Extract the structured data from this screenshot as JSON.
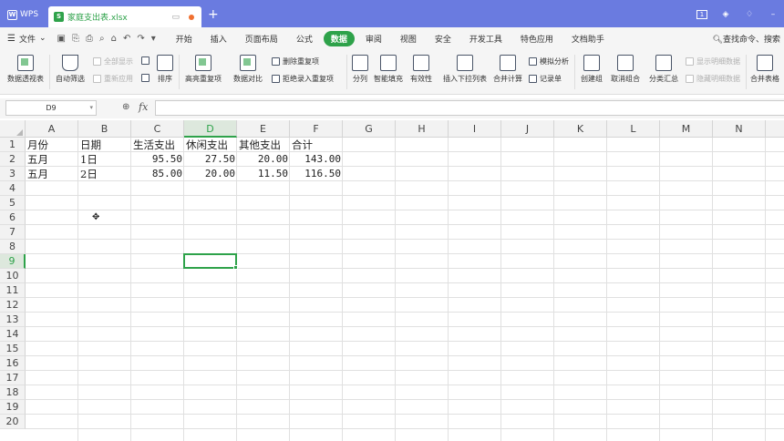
{
  "app": {
    "name": "WPS",
    "doc_title": "家庭支出表.xlsx"
  },
  "menu": {
    "file": "文件",
    "tabs": [
      "开始",
      "插入",
      "页面布局",
      "公式",
      "数据",
      "审阅",
      "视图",
      "安全",
      "开发工具",
      "特色应用",
      "文档助手"
    ],
    "active_tab": "数据",
    "search": "查找命令、搜索"
  },
  "ribbon": {
    "pivot": "数据透视表",
    "autofilter": "自动筛选",
    "show_all": "全部显示",
    "reapply": "重新应用",
    "sort": "排序",
    "highlight_dup": "高亮重复项",
    "compare": "数据对比",
    "remove_dup": "删除重复项",
    "reject_dup": "拒绝录入重复项",
    "split": "分列",
    "smart_fill": "智能填充",
    "validity": "有效性",
    "insert_dropdown": "插入下拉列表",
    "consolidate": "合并计算",
    "what_if": "模拟分析",
    "record": "记录单",
    "group": "创建组",
    "ungroup": "取消组合",
    "subtotal": "分类汇总",
    "show_detail": "显示明细数据",
    "hide_detail": "隐藏明细数据",
    "merge_tables": "合并表格"
  },
  "formula_bar": {
    "name_box": "D9",
    "fx": "fx",
    "formula": ""
  },
  "sheet": {
    "columns": [
      "A",
      "B",
      "C",
      "D",
      "E",
      "F",
      "G",
      "H",
      "I",
      "J",
      "K",
      "L",
      "M",
      "N"
    ],
    "active_column": "D",
    "active_row": 9,
    "rows": 20,
    "headers": [
      "月份",
      "日期",
      "生活支出",
      "休闲支出",
      "其他支出",
      "合计"
    ],
    "data": [
      [
        "五月",
        "1日",
        "95.50",
        "27.50",
        "20.00",
        "143.00"
      ],
      [
        "五月",
        "2日",
        "85.00",
        "20.00",
        "11.50",
        "116.50"
      ]
    ]
  }
}
